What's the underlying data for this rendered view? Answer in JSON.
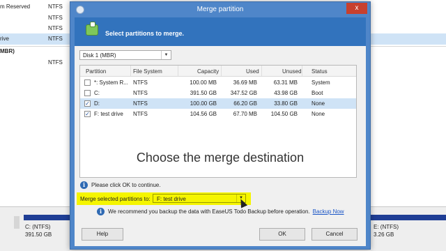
{
  "background": {
    "rows": [
      {
        "name": "m Reserved",
        "fs": "NTFS",
        "selected": false
      },
      {
        "name": "",
        "fs": "NTFS",
        "selected": false
      },
      {
        "name": "",
        "fs": "NTFS",
        "selected": false
      },
      {
        "name": "rive",
        "fs": "NTFS",
        "selected": true
      }
    ],
    "group_label": "MBR)",
    "group_rows": [
      {
        "name": "",
        "fs": "NTFS"
      }
    ],
    "disk_labels": {
      "c_name": "C: (NTFS)",
      "c_size": "391.50 GB",
      "e_name": "E: (NTFS)",
      "e_size": "3.26 GB"
    }
  },
  "dialog": {
    "title": "Merge partition",
    "close_label": "x",
    "header": "Select partitions to merge.",
    "disk_select": "Disk 1 (MBR)",
    "table": {
      "headers": [
        "Partition",
        "File System",
        "Capacity",
        "Used",
        "Unused",
        "Status"
      ],
      "rows": [
        {
          "checked": false,
          "partition": "*: System R...",
          "fs": "NTFS",
          "capacity": "100.00 MB",
          "used": "36.69 MB",
          "unused": "63.31 MB",
          "status": "System",
          "selected": false
        },
        {
          "checked": false,
          "partition": "C:",
          "fs": "NTFS",
          "capacity": "391.50 GB",
          "used": "347.52 GB",
          "unused": "43.98 GB",
          "status": "Boot",
          "selected": false
        },
        {
          "checked": true,
          "partition": "D:",
          "fs": "NTFS",
          "capacity": "100.00 GB",
          "used": "66.20 GB",
          "unused": "33.80 GB",
          "status": "None",
          "selected": true
        },
        {
          "checked": true,
          "partition": "F: test drive",
          "fs": "NTFS",
          "capacity": "104.56 GB",
          "used": "67.70 MB",
          "unused": "104.50 GB",
          "status": "None",
          "selected": false
        }
      ]
    },
    "overlay_caption": "Choose the merge destination",
    "info_text": "Please click OK to continue.",
    "merge_label": "Merge selected partitions to:",
    "merge_target": "F: test drive",
    "recommend_text": "We recommend you backup the data with EaseUS Todo Backup before operation.",
    "backup_link": "Backup Now",
    "buttons": {
      "help": "Help",
      "ok": "OK",
      "cancel": "Cancel"
    }
  }
}
